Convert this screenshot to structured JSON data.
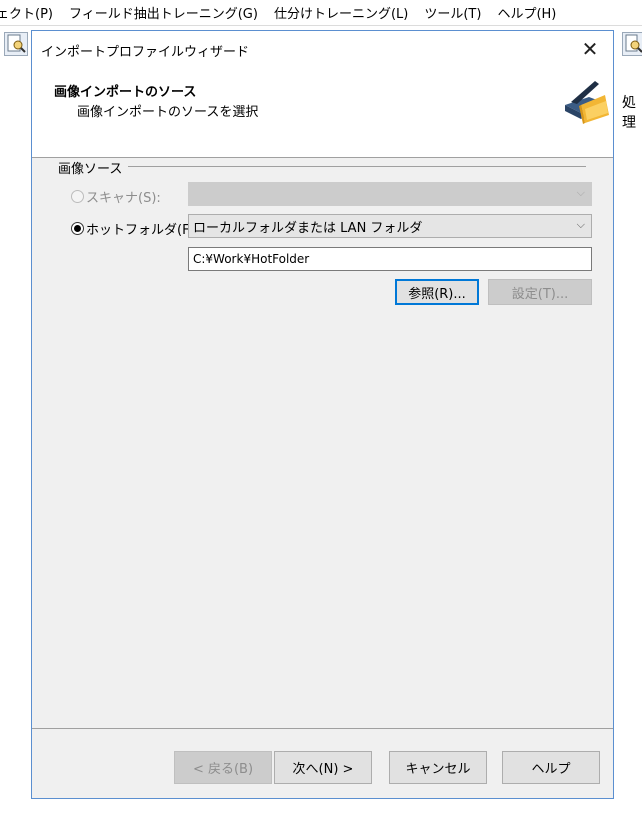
{
  "app": {
    "menus": [
      "ェクト(P)",
      "フィールド抽出トレーニング(G)",
      "仕分けトレーニング(L)",
      "ツール(T)",
      "ヘルプ(H)"
    ],
    "side_text": "処理"
  },
  "dialog": {
    "title": "インポートプロファイルウィザード",
    "close_glyph": "✕",
    "header": {
      "title": "画像インポートのソース",
      "subtitle": "画像インポートのソースを選択",
      "icon": "scanner-folder-icon"
    },
    "group_label": "画像ソース",
    "scanner": {
      "label": "スキャナ(S):",
      "selected": false,
      "enabled": false,
      "combo_value": ""
    },
    "hotfolder": {
      "label": "ホットフォルダ(F):",
      "selected": true,
      "combo_value": "ローカルフォルダまたは LAN フォルダ",
      "path_value": "C:¥Work¥HotFolder"
    },
    "browse_label": "参照(R)...",
    "settings_label": "設定(T)...",
    "buttons": {
      "back": "< 戻る(B)",
      "next": "次へ(N) >",
      "cancel": "キャンセル",
      "help": "ヘルプ"
    },
    "colors": {
      "dialog_bg": "#f0f0f0",
      "accent": "#0078d7",
      "border": "#5b8fd0"
    }
  }
}
